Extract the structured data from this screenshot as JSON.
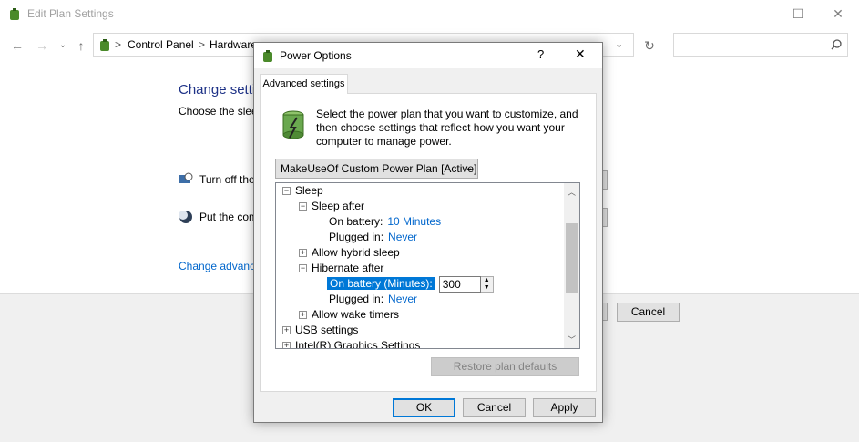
{
  "bg_window": {
    "title": "Edit Plan Settings",
    "controls": {
      "minimize": "—",
      "maximize": "☐",
      "close": "✕"
    },
    "nav": {
      "back": "←",
      "forward": "→",
      "recent": "⌄",
      "up": "↑",
      "refresh": "↻",
      "dropdown": "⌄"
    },
    "breadcrumbs": [
      "Control Panel",
      "Hardware"
    ],
    "crumb_sep": ">",
    "search_placeholder": "",
    "heading": "Change setti",
    "choose_text": "Choose the sleep",
    "turn_off_label": "Turn off the",
    "put_computer_label": "Put the com",
    "advanced_link": "Change advance",
    "cancel_button": "Cancel"
  },
  "dialog": {
    "title": "Power Options",
    "help": "?",
    "close": "✕",
    "tab": "Advanced settings",
    "description": "Select the power plan that you want to customize, and then choose settings that reflect how you want your computer to manage power.",
    "plan_selected": "MakeUseOf Custom Power Plan [Active]",
    "tree": [
      {
        "label": "Sleep",
        "expander": "−"
      },
      {
        "label": "Sleep after",
        "expander": "−"
      },
      {
        "label": "On battery:",
        "value": "10 Minutes"
      },
      {
        "label": "Plugged in:",
        "value": "Never"
      },
      {
        "label": "Allow hybrid sleep",
        "expander": "+"
      },
      {
        "label": "Hibernate after",
        "expander": "−"
      },
      {
        "label": "On battery (Minutes):",
        "value": "300"
      },
      {
        "label": "Plugged in:",
        "value": "Never"
      },
      {
        "label": "Allow wake timers",
        "expander": "+"
      },
      {
        "label": "USB settings",
        "expander": "+"
      },
      {
        "label": "Intel(R) Graphics Settings",
        "expander": "+"
      }
    ],
    "restore_button": "Restore plan defaults",
    "ok_button": "OK",
    "cancel_button": "Cancel",
    "apply_button": "Apply"
  }
}
